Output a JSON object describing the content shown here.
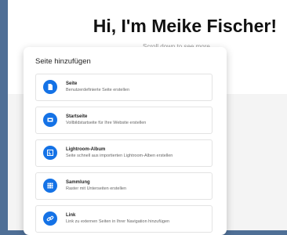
{
  "background_page": {
    "heading": "Hi, I'm Meike Fischer!",
    "subheading": "Scroll down to see more"
  },
  "dialog": {
    "title": "Seite hinzufügen",
    "options": [
      {
        "icon": "page-icon",
        "title": "Seite",
        "description": "Benutzerdefinierte Seite erstellen"
      },
      {
        "icon": "landing-page-icon",
        "title": "Startseite",
        "description": "Vollbildstartseite für Ihre Website erstellen"
      },
      {
        "icon": "lightroom-icon",
        "title": "Lightroom-Album",
        "description": "Seite schnell aus importierten Lightroom-Alben erstellen"
      },
      {
        "icon": "grid-icon",
        "title": "Sammlung",
        "description": "Raster mit Unterseiten erstellen"
      },
      {
        "icon": "link-icon",
        "title": "Link",
        "description": "Link zu externen Seiten in Ihrer Navigation hinzufügen"
      }
    ]
  },
  "colors": {
    "backdrop": "#4f6f96",
    "accent": "#1472e6"
  }
}
